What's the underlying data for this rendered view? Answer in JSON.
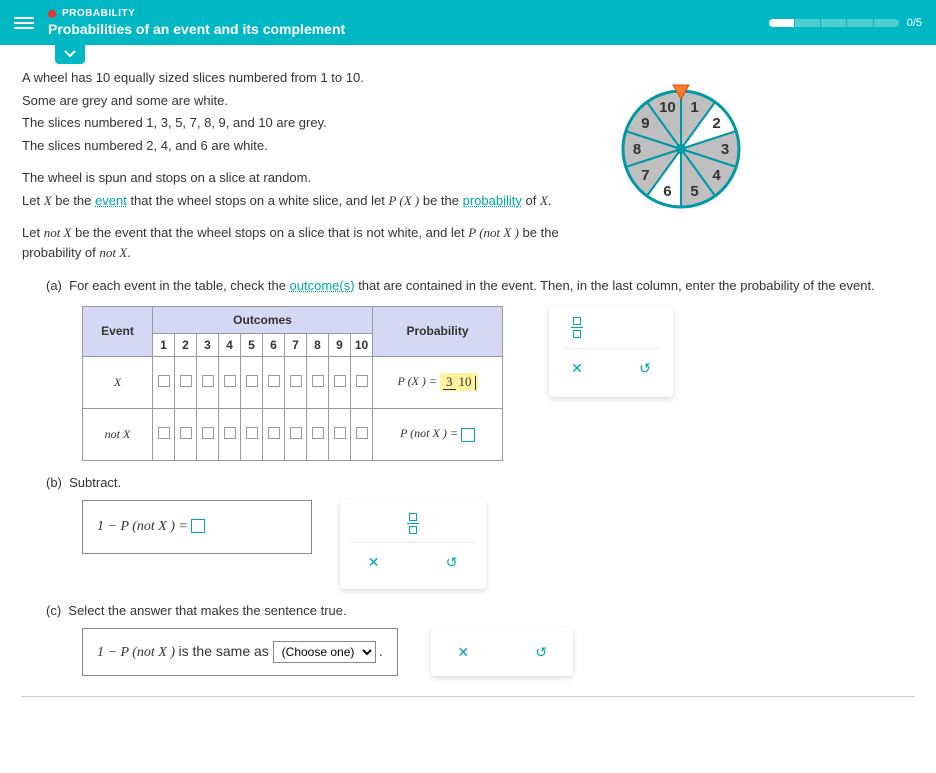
{
  "header": {
    "category": "PROBABILITY",
    "title": "Probabilities of an event and its complement",
    "progress": "0/5"
  },
  "problem": {
    "line1_a": "A wheel has ",
    "line1_num": "10",
    "line1_b": " equally sized slices numbered from ",
    "line1_from": "1",
    "line1_c": " to ",
    "line1_to": "10",
    "line1_d": ".",
    "line2": "Some are grey and some are white.",
    "line3_a": "The slices numbered ",
    "line3_nums": "1, 3, 5, 7, 8, 9,",
    "line3_b": " and ",
    "line3_last": "10",
    "line3_c": " are grey.",
    "line4_a": "The slices numbered ",
    "line4_nums": "2, 4,",
    "line4_b": " and ",
    "line4_last": "6",
    "line4_c": " are white.",
    "line5": "The wheel is spun and stops on a slice at random.",
    "line6_a": "Let ",
    "line6_X": "X",
    "line6_b": " be the ",
    "line6_event": "event",
    "line6_c": " that the wheel stops on a white slice, and let ",
    "line6_px": "P (X )",
    "line6_d": " be the ",
    "line6_prob": "probability",
    "line6_e": " of ",
    "line6_X2": "X",
    "line6_f": ".",
    "line7_a": "Let ",
    "line7_notX": "not X",
    "line7_b": " be the event that the wheel stops on a slice that is not white, and let ",
    "line7_pnx": "P (not X )",
    "line7_c": " be the probability of ",
    "line7_notX2": "not X",
    "line7_d": "."
  },
  "wheel": {
    "slices": [
      {
        "n": "1",
        "grey": true
      },
      {
        "n": "2",
        "grey": false
      },
      {
        "n": "3",
        "grey": true
      },
      {
        "n": "4",
        "grey": true
      },
      {
        "n": "5",
        "grey": true
      },
      {
        "n": "6",
        "grey": false
      },
      {
        "n": "7",
        "grey": true
      },
      {
        "n": "8",
        "grey": true
      },
      {
        "n": "9",
        "grey": true
      },
      {
        "n": "10",
        "grey": true
      }
    ]
  },
  "parts": {
    "a_label": "(a)",
    "a_text_1": "For each event in the table, check the ",
    "a_text_link": "outcome(s)",
    "a_text_2": " that are contained in the event. Then, in the last column, enter the probability of the event.",
    "b_label": "(b)",
    "b_text": "Subtract.",
    "c_label": "(c)",
    "c_text": "Select the answer that makes the sentence true."
  },
  "table": {
    "hdr_event": "Event",
    "hdr_outcomes": "Outcomes",
    "hdr_prob": "Probability",
    "cols": [
      "1",
      "2",
      "3",
      "4",
      "5",
      "6",
      "7",
      "8",
      "9",
      "10"
    ],
    "row1_event": "X",
    "row1_prob_lhs": "P (X ) = ",
    "row1_num": "3",
    "row1_den": "10",
    "row2_event": "not X",
    "row2_prob_lhs": "P (not X ) = "
  },
  "subtract": {
    "expr": "1 − P (not X ) = "
  },
  "partc": {
    "lhs": "1 − P (not X ) ",
    "mid": "is the same as ",
    "select_placeholder": "(Choose one)",
    "tail": "."
  },
  "icons": {
    "close": "✕",
    "undo": "↺"
  }
}
